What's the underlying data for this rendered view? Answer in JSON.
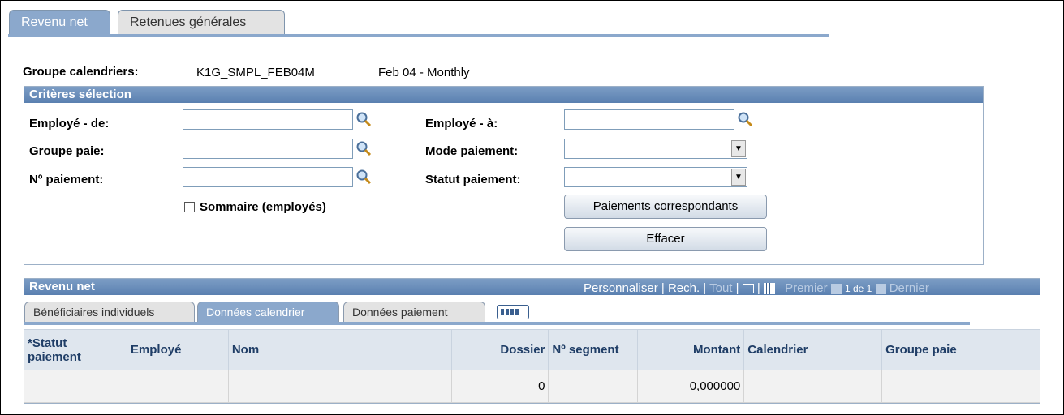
{
  "tabs": [
    {
      "label": "Revenu net",
      "active": true
    },
    {
      "label": "Retenues générales",
      "active": false
    }
  ],
  "calendar_group": {
    "label": "Groupe calendriers:",
    "code": "K1G_SMPL_FEB04M",
    "description": "Feb 04 - Monthly"
  },
  "criteria": {
    "title": "Critères sélection",
    "employee_from_label": "Employé - de:",
    "employee_to_label": "Employé - à:",
    "pay_group_label": "Groupe paie:",
    "pay_mode_label": "Mode paiement:",
    "payment_no_label": "Nº paiement:",
    "payment_status_label": "Statut paiement:",
    "summary_label": "Sommaire (employés)",
    "summary_checked": false,
    "match_button": "Paiements correspondants",
    "clear_button": "Effacer"
  },
  "grid": {
    "title": "Revenu net",
    "nav": {
      "customize": "Personnaliser",
      "find": "Rech.",
      "all": "Tout",
      "first": "Premier",
      "range": "1 de 1",
      "last": "Dernier"
    },
    "subtabs": [
      {
        "label": "Bénéficiaires individuels",
        "active": false
      },
      {
        "label": "Données calendrier",
        "active": true
      },
      {
        "label": "Données paiement",
        "active": false
      }
    ],
    "columns": [
      "*Statut paiement",
      "Employé",
      "Nom",
      "Dossier",
      "Nº segment",
      "Montant",
      "Calendrier",
      "Groupe paie"
    ],
    "rows": [
      {
        "status": "",
        "employee": "",
        "name": "",
        "file": "0",
        "segment": "",
        "amount": "0,000000",
        "calendar": "",
        "pay_group": ""
      }
    ]
  },
  "colors": {
    "tab_active": "#8ba8cc",
    "header": "#5a80b0",
    "grid_header": "#dfe6ee"
  }
}
